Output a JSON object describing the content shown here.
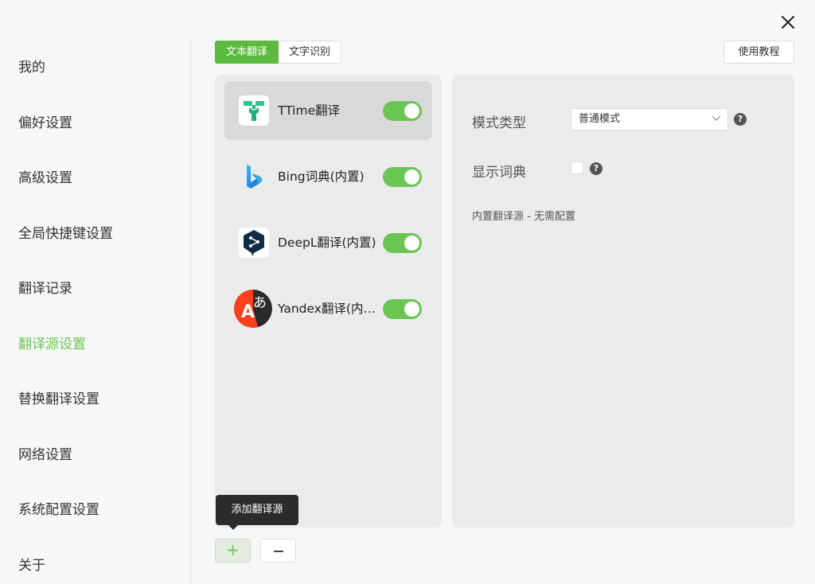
{
  "sidebar": {
    "items": [
      {
        "label": "我的"
      },
      {
        "label": "偏好设置"
      },
      {
        "label": "高级设置"
      },
      {
        "label": "全局快捷键设置"
      },
      {
        "label": "翻译记录"
      },
      {
        "label": "翻译源设置",
        "active": true
      },
      {
        "label": "替换翻译设置"
      },
      {
        "label": "网络设置"
      },
      {
        "label": "系统配置设置"
      },
      {
        "label": "关于"
      }
    ]
  },
  "tabs": [
    {
      "label": "文本翻译",
      "active": true
    },
    {
      "label": "文字识别"
    }
  ],
  "tutorial_button": "使用教程",
  "sources": [
    {
      "name": "TTime翻译",
      "enabled": true,
      "icon": "ttime-logo-icon"
    },
    {
      "name": "Bing词典(内置)",
      "enabled": true,
      "icon": "bing-logo-icon"
    },
    {
      "name": "DeepL翻译(内置)",
      "enabled": true,
      "icon": "deepl-logo-icon"
    },
    {
      "name": "Yandex翻译(内置)",
      "enabled": true,
      "icon": "yandex-logo-icon"
    }
  ],
  "settings": {
    "mode_label": "模式类型",
    "mode_value": "普通模式",
    "dict_label": "显示词典",
    "dict_checked": false,
    "info": "内置翻译源 - 无需配置"
  },
  "tooltip": "添加翻译源",
  "colors": {
    "accent": "#6ac552",
    "tab_active": "#5cbb3e",
    "tooltip_bg": "#2b2b2b"
  }
}
